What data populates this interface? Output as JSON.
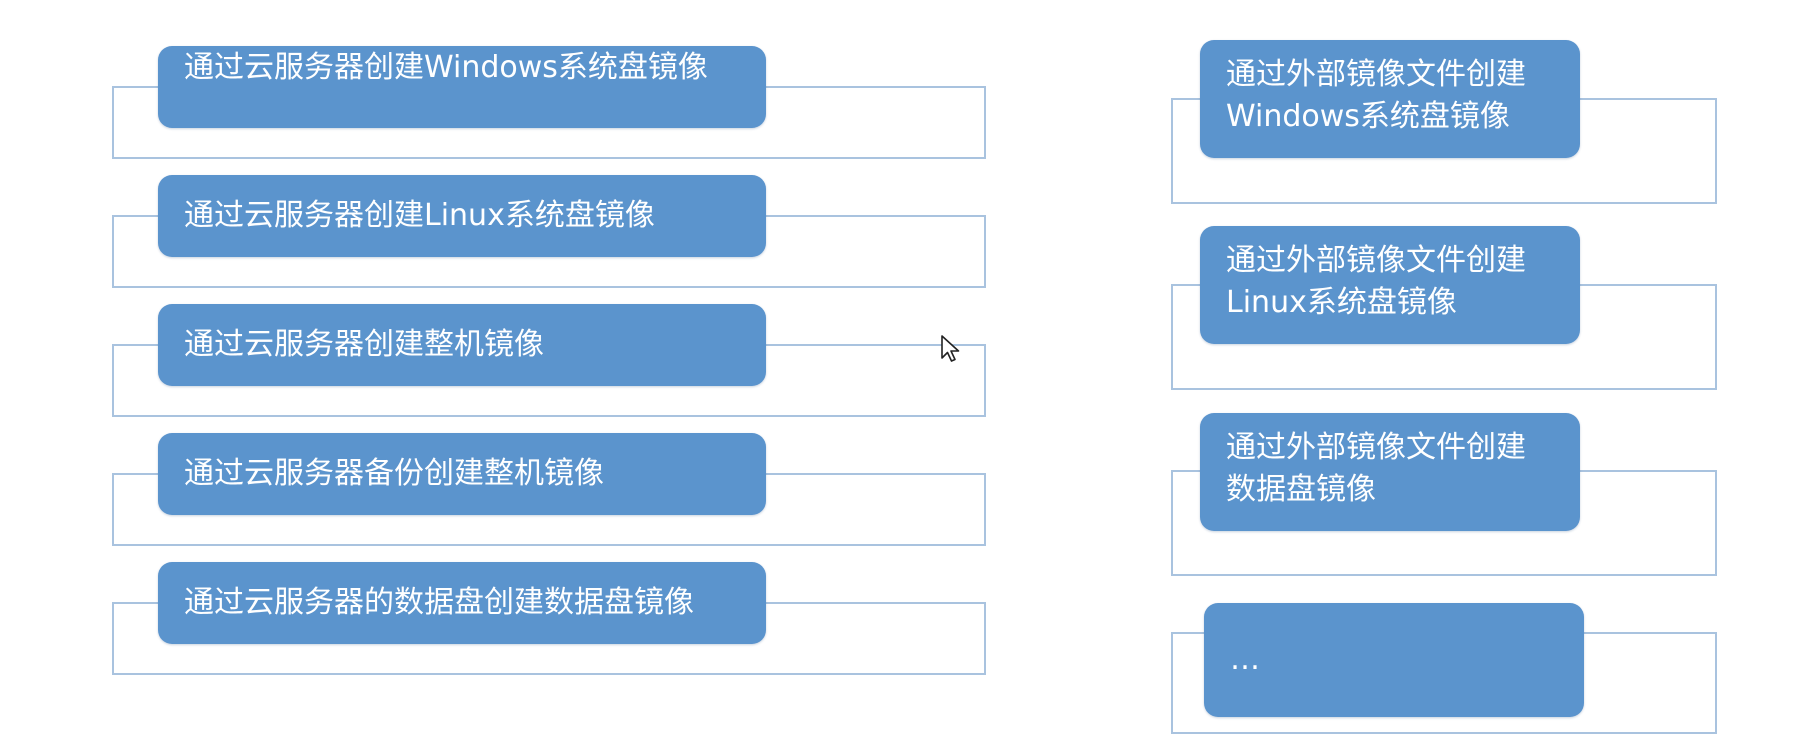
{
  "diagram": {
    "left_items": [
      "通过云服务器创建Windows系统盘镜像",
      "通过云服务器创建Linux系统盘镜像",
      "通过云服务器创建整机镜像",
      "通过云服务器备份创建整机镜像",
      "通过云服务器的数据盘创建数据盘镜像"
    ],
    "right_items": [
      "通过外部镜像文件创建Windows系统盘镜像",
      "通过外部镜像文件创建Linux系统盘镜像",
      "通过外部镜像文件创建数据盘镜像",
      "…"
    ]
  },
  "colors": {
    "pill_fill": "#5b94cd",
    "frame_border": "#a9c3df",
    "text": "#ffffff"
  },
  "icons": {
    "cursor": "mouse-pointer-icon"
  }
}
